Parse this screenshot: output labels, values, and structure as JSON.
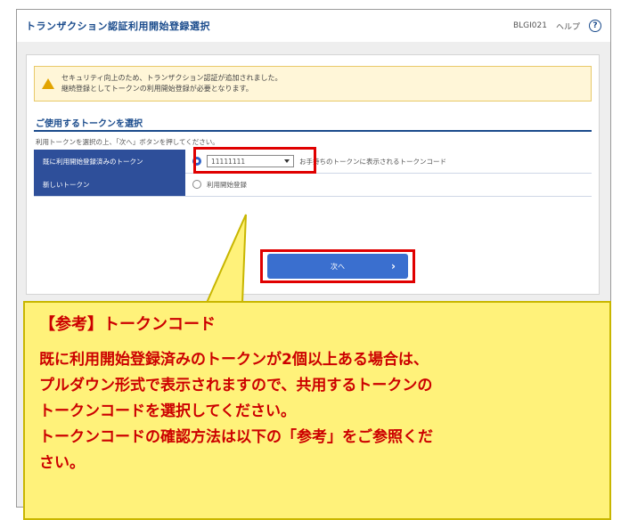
{
  "header": {
    "title": "トランザクション認証利用開始登録選択",
    "screen_id": "BLGI021",
    "help_label": "ヘルプ"
  },
  "warning": {
    "line1": "セキュリティ向上のため、トランザクション認証が追加されました。",
    "line2": "継続登録としてトークンの利用開始登録が必要となります。"
  },
  "section": {
    "title": "ご使用するトークンを選択",
    "instruction": "利用トークンを選択の上、「次へ」ボタンを押してください。"
  },
  "rows": [
    {
      "label": "既に利用開始登録済みのトークン",
      "select_value": "11111111",
      "note": "お手持ちのトークンに表示されるトークンコード"
    },
    {
      "label": "新しいトークン",
      "option_label": "利用開始登録"
    }
  ],
  "next_button": {
    "label": "次へ",
    "arrow": "›"
  },
  "callout": {
    "heading": "【参考】トークンコード",
    "line1": "既に利用開始登録済みのトークンが2個以上ある場合は、",
    "line2": "プルダウン形式で表示されますので、共用するトークンの",
    "line3": "トークンコードを選択してください。",
    "line4": "トークンコードの確認方法は以下の「参考」をご参照くだ",
    "line5": "さい。"
  }
}
